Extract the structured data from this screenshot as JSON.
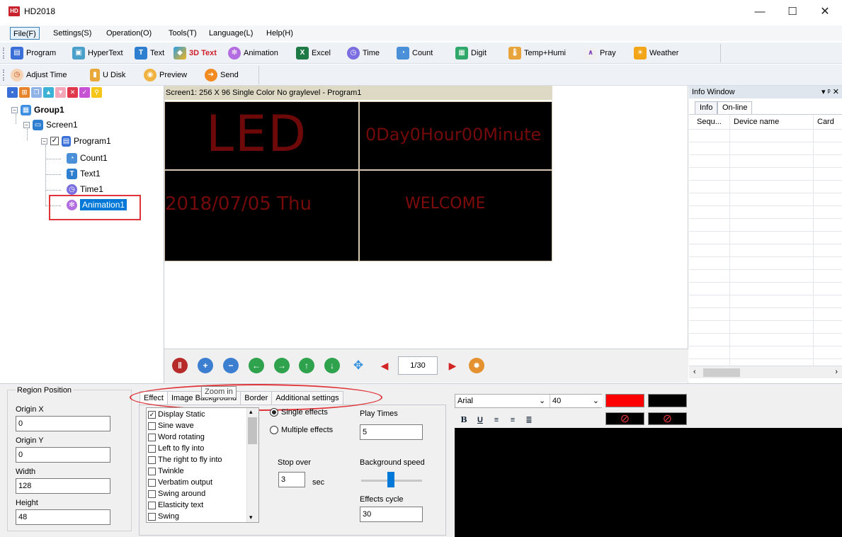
{
  "window": {
    "app_logo": "HD",
    "title": "HD2018",
    "min_glyph": "—",
    "max_glyph": "☐",
    "close_glyph": "✕"
  },
  "menu": [
    "File(F)",
    "Settings(S)",
    "Operation(O)",
    "Tools(T)",
    "Language(L)",
    "Help(H)"
  ],
  "toolbar1": [
    "Program",
    "HyperText",
    "Text",
    "3D Text",
    "Animation",
    "Excel",
    "Time",
    "Count",
    "Digit",
    "Temp+Humi",
    "Pray",
    "Weather"
  ],
  "toolbar2": [
    "Adjust Time",
    "U Disk",
    "Preview",
    "Send"
  ],
  "tree": {
    "group": "Group1",
    "screen": "Screen1",
    "program": "Program1",
    "items": [
      "Count1",
      "Text1",
      "Time1",
      "Animation1"
    ]
  },
  "screen": {
    "header": "Screen1: 256 X 96  Single Color No graylevel - Program1",
    "led_text": "LED",
    "count_text": "0Day0Hour00Minute",
    "date_text": "2018/07/05  Thu",
    "welcome_text": "WELCOME",
    "page": "1/30"
  },
  "info_window": {
    "title": "Info Window",
    "title_controls": "▾ ᵖ ✕",
    "tabs": [
      "Info",
      "On-line"
    ],
    "columns": [
      "Sequ...",
      "Device name",
      "Card"
    ]
  },
  "region": {
    "title": "Region Position",
    "origin_x_label": "Origin X",
    "origin_x": "0",
    "origin_y_label": "Origin Y",
    "origin_y": "0",
    "width_label": "Width",
    "width": "128",
    "height_label": "Height",
    "height": "48"
  },
  "tabs": [
    "Effect",
    "Image Background",
    "Border",
    "Additional settings"
  ],
  "tooltip": "Zoom in",
  "effects": [
    "Display Static",
    "Sine wave",
    "Word rotating",
    "Left to fly into",
    "The right to fly into",
    "Twinkle",
    "Verbatim output",
    "Swing around",
    "Elasticity text",
    "Swing"
  ],
  "effect_options": {
    "single": "Single effects",
    "multiple": "Multiple effects",
    "play_times_label": "Play Times",
    "play_times": "5",
    "stop_over_label": "Stop over",
    "stop_over": "3",
    "sec": "sec",
    "bg_speed_label": "Background speed",
    "cycle_label": "Effects cycle",
    "cycle": "30"
  },
  "font": {
    "family": "Arial",
    "size": "40"
  },
  "colors": {
    "accent": "#0078d7",
    "led_red": "#7f0b0b",
    "highlight": "#e0353b",
    "fore": "#ff0000",
    "back": "#000000"
  }
}
